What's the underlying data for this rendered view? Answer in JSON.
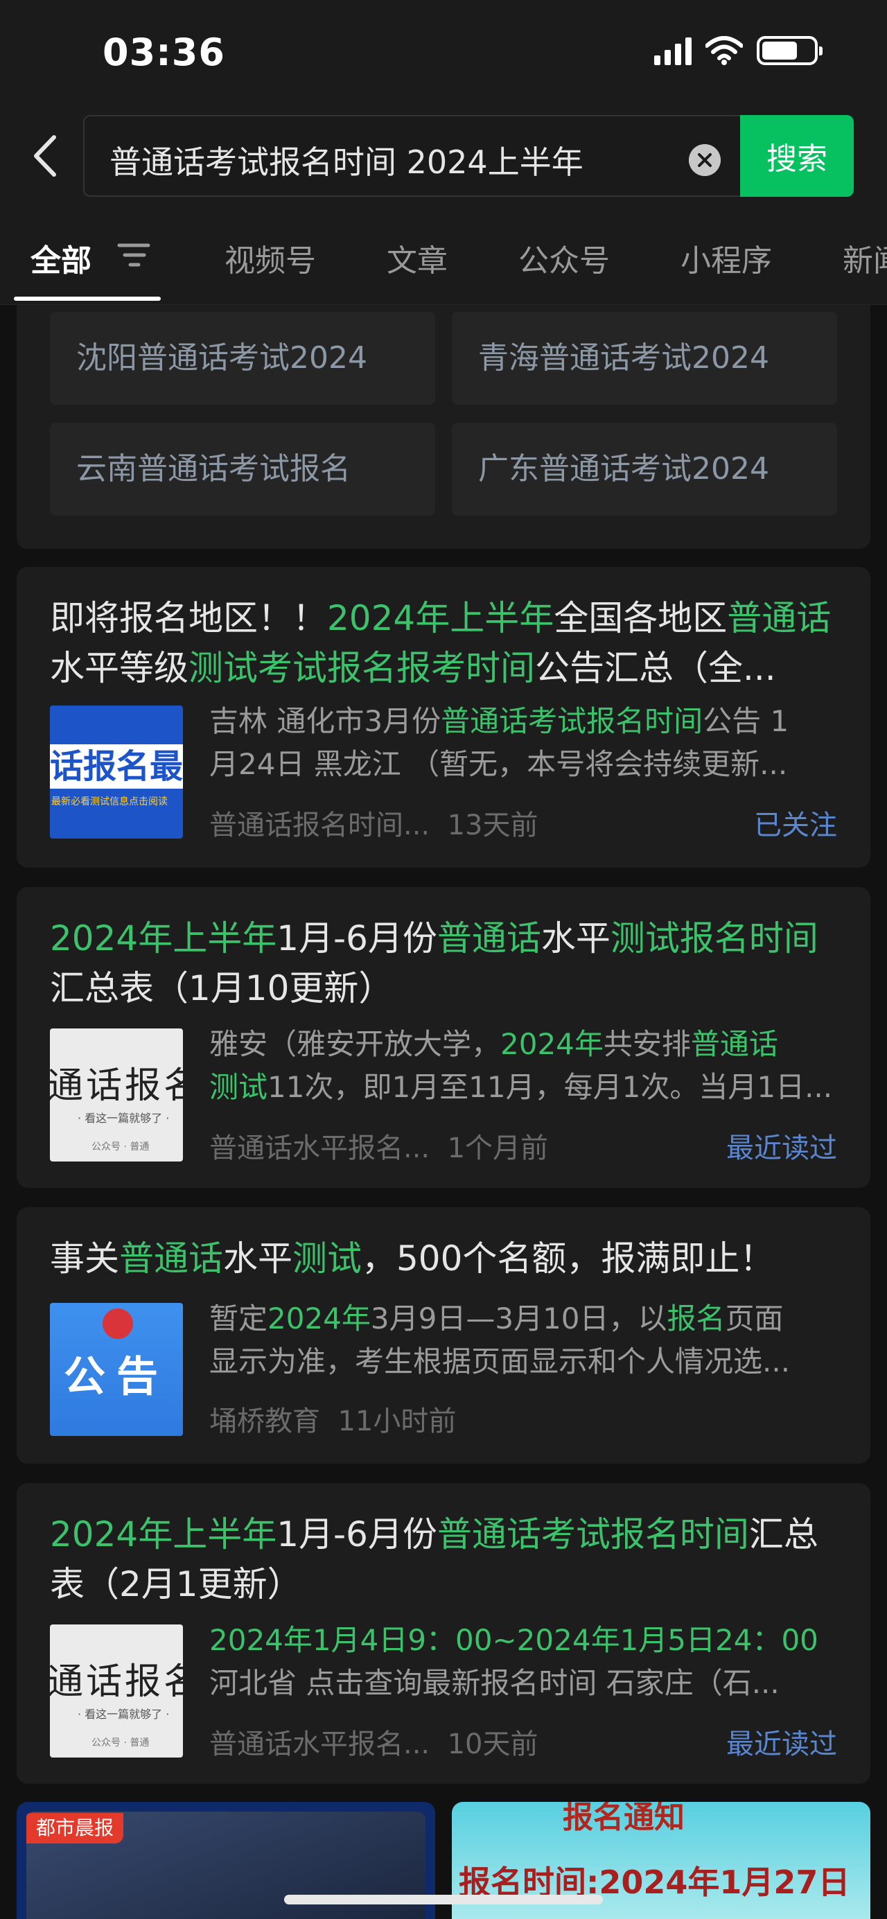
{
  "status_bar": {
    "time": "03:36",
    "battery_level": 0.7
  },
  "search": {
    "query": "普通话考试报名时间 2024上半年",
    "button_label": "搜索"
  },
  "tabs": [
    {
      "label": "全部",
      "active": true
    },
    {
      "label": "视频号",
      "active": false
    },
    {
      "label": "文章",
      "active": false
    },
    {
      "label": "公众号",
      "active": false
    },
    {
      "label": "小程序",
      "active": false
    },
    {
      "label": "新闻",
      "active": false
    }
  ],
  "suggestions": [
    "沈阳普通话考试2024",
    "青海普通话考试2024",
    "云南普通话考试报名",
    "广东普通话考试2024"
  ],
  "articles": [
    {
      "title": [
        {
          "text": "即将报名地区！！",
          "hl": false
        },
        {
          "text": "2024年上半年",
          "hl": true
        },
        {
          "text": "全国各地区",
          "hl": false
        },
        {
          "text": "普通话",
          "hl": true
        },
        {
          "text": "水平等级",
          "hl": false
        },
        {
          "text": "测试考试报名报考时间",
          "hl": true
        },
        {
          "text": "公告汇总（全...",
          "hl": false
        }
      ],
      "snippet_lines": [
        [
          {
            "text": "吉林 通化市3月份",
            "hl": false
          },
          {
            "text": "普通话考试报名时间",
            "hl": true
          },
          {
            "text": "公告 1",
            "hl": false
          }
        ],
        [
          {
            "text": "月24日 黑龙江 （暂无，本号将会持续更新...",
            "hl": false
          }
        ]
      ],
      "thumb": {
        "style": "blue",
        "big": "话报名最新",
        "small": "最新必看测试信息点击阅读"
      },
      "source": "普通话报名时间...",
      "time": "13天前",
      "tag": "已关注"
    },
    {
      "title": [
        {
          "text": "2024年上半年",
          "hl": true
        },
        {
          "text": "1月-6月份",
          "hl": false
        },
        {
          "text": "普通话",
          "hl": true
        },
        {
          "text": "水平",
          "hl": false
        },
        {
          "text": "测试报名时间",
          "hl": true
        },
        {
          "text": "汇总表（1月10更新）",
          "hl": false
        }
      ],
      "snippet_lines": [
        [
          {
            "text": "雅安（雅安开放大学，",
            "hl": false
          },
          {
            "text": "2024年",
            "hl": true
          },
          {
            "text": "共安排",
            "hl": false
          },
          {
            "text": "普通话",
            "hl": true
          }
        ],
        [
          {
            "text": "测试",
            "hl": true
          },
          {
            "text": "11次，即1月至11月，每月1次。当月1日...",
            "hl": false
          }
        ]
      ],
      "thumb": {
        "style": "white",
        "big": "通话报名汇",
        "small": "· 看这一篇就够了 ·",
        "small2": "公众号 · 普通"
      },
      "source": "普通话水平报名...",
      "time": "1个月前",
      "tag": "最近读过"
    },
    {
      "title": [
        {
          "text": "事关",
          "hl": false
        },
        {
          "text": "普通话",
          "hl": true
        },
        {
          "text": "水平",
          "hl": false
        },
        {
          "text": "测试",
          "hl": true
        },
        {
          "text": "，500个名额，报满即止！",
          "hl": false
        }
      ],
      "snippet_lines": [
        [
          {
            "text": "暂定",
            "hl": false
          },
          {
            "text": "2024年",
            "hl": true
          },
          {
            "text": "3月9日—3月10日，以",
            "hl": false
          },
          {
            "text": "报名",
            "hl": true
          },
          {
            "text": "页面",
            "hl": false
          }
        ],
        [
          {
            "text": "显示为准，考生根据页面显示和个人情况选...",
            "hl": false
          }
        ]
      ],
      "thumb": {
        "style": "notice",
        "big": "公告"
      },
      "source": "埇桥教育",
      "time": "11小时前",
      "tag": ""
    },
    {
      "title": [
        {
          "text": "2024年上半年",
          "hl": true
        },
        {
          "text": "1月-6月份",
          "hl": false
        },
        {
          "text": "普通话考试报名时间",
          "hl": true
        },
        {
          "text": "汇总表（2月1更新）",
          "hl": false
        }
      ],
      "snippet_lines": [
        [
          {
            "text": "2024年1月4日9：00~2024年1月5日24：00",
            "hl": true
          }
        ],
        [
          {
            "text": "河北省 点击查询最新报名时间 石家庄（石...",
            "hl": false
          }
        ]
      ],
      "thumb": {
        "style": "white",
        "big": "通话报名汇",
        "small": "· 看这一篇就够了 ·",
        "small2": "公众号 · 普通"
      },
      "source": "普通话水平报名...",
      "time": "10天前",
      "tag": "最近读过"
    }
  ],
  "media": {
    "left_badge": "都市晨报",
    "right_head": "报名通知",
    "right_body": "报名时间:2024年1月27日"
  },
  "colors": {
    "accent": "#07c160",
    "highlight": "#3bc26b",
    "tag": "#5a86cf",
    "background": "#111111"
  }
}
